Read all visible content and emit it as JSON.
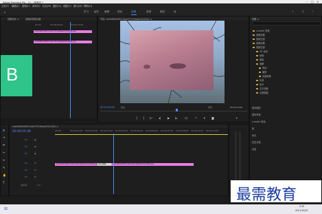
{
  "window_title": "Adobe Premiere Pro - C:\\...\\未命名 *",
  "menu": [
    "文件(F)",
    "编辑(E)",
    "剪辑(C)",
    "序列(S)",
    "标记(M)",
    "图形(G)",
    "视图(V)",
    "窗口(W)",
    "帮助(H)"
  ],
  "workspaces": [
    "学习",
    "组件",
    "编辑",
    "颜色",
    "效果",
    "音频",
    "图形",
    "库"
  ],
  "active_workspace": "效果",
  "source_panel": {
    "title": "效果控件 ≡",
    "tab2": "音频剪辑混合器",
    "clip_name": "cde9465ef4f07c4de7f7416aeb33c2284.jpg",
    "clip_sub": "cde9465ef4f07c4de7f7416aeb33c2284.jpg",
    "timecode_a": "00:00",
    "timecode_b": "00:00:05:00",
    "timecode_c": "00:00:10:00",
    "thumb_letter": "B"
  },
  "program_monitor": {
    "title": "节目: cde9465ef4f07c4de7f7416aeb33c2284 ≡",
    "current_time": "00:00:05:08",
    "fit_label": "适合",
    "quality_label": "完整",
    "duration": "00:00:10:00"
  },
  "effects_panel": {
    "title": "效果 ≡",
    "search_placeholder": "",
    "tree": [
      "Lumetri 预设",
      "音频效果",
      "音频过渡",
      "视频效果",
      "视频过渡",
      "3D 运动",
      "划像",
      "擦除",
      "溶解",
      "滑动",
      "缩放",
      "页面剥落",
      "内滑",
      "拆分",
      "交叉划像",
      "过渡模板"
    ],
    "sub_panels": [
      "基本图形",
      "基本声音",
      "Lumetri 颜色",
      "库",
      "标记",
      "历史记录",
      "信息"
    ]
  },
  "timeline": {
    "sequence_name": "cde9465ef4f07c4de7f7416aeb33c2284 ≡",
    "timecode": "00:00:05:08",
    "ruler": [
      "00:00",
      "00:00:01:00",
      "00:00:02:00",
      "00:00:03:00",
      "00:00:04:00",
      "00:00:05:00",
      "00:00:06:00",
      "00:00:07:00",
      "00:00:08:00",
      "00:00:09:00",
      "00:00:10:00"
    ],
    "video_tracks": [
      "V3",
      "V2",
      "V1"
    ],
    "audio_tracks": [
      "A1",
      "A2",
      "A3"
    ],
    "master_label": "主声道",
    "master_value": "0.0",
    "clip_a": "cde9465ef4f07c4de7f7416aeb33c2284.jpg",
    "transition_label": "交叉溶解",
    "clip_b": "cde9465ef4f07c4de7f7416aeb33c2284.jpg",
    "clip_v1": "cde9465ef4f07c4de7f7416aeb33c2284.jpg"
  },
  "watermark": "最需教育",
  "taskbar": {
    "time": "9:45",
    "date": "2021/10/25"
  },
  "colors": {
    "accent": "#4d8ff2",
    "clip": "#e67ee2",
    "thumb": "#2fc48a"
  }
}
